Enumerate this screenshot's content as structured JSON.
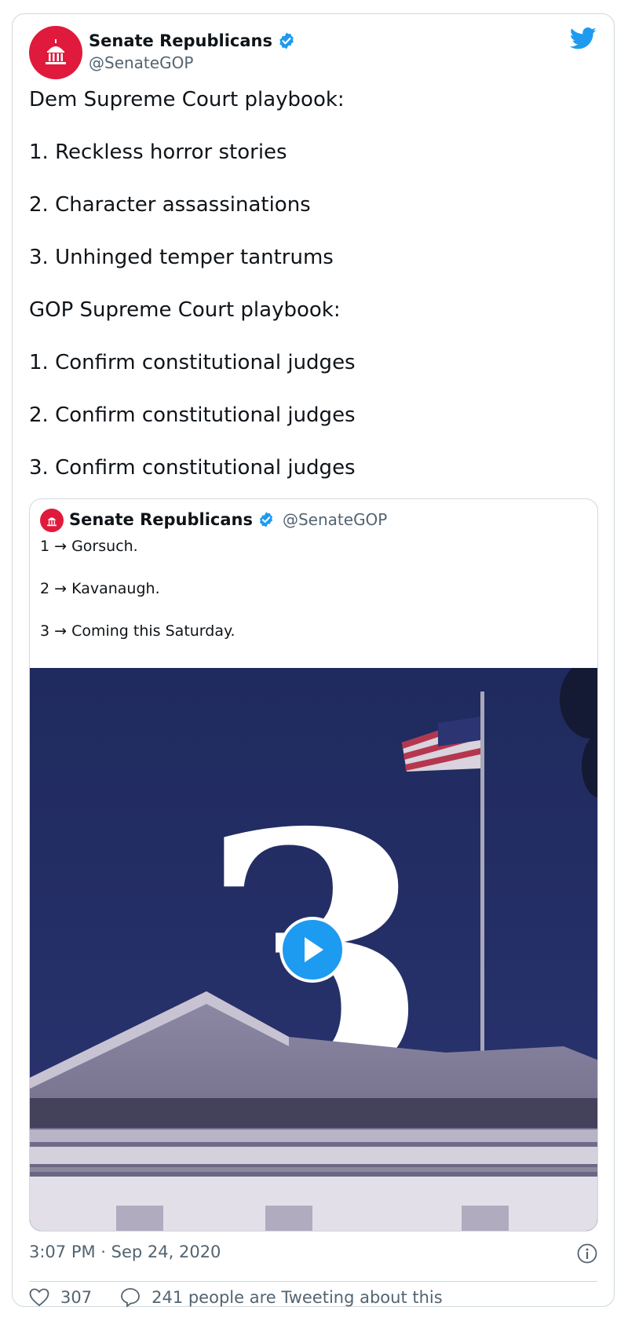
{
  "author": {
    "name": "Senate Republicans",
    "handle": "@SenateGOP",
    "avatar_color": "#e01a3c",
    "verified_icon": "verified-badge-icon"
  },
  "platform_icon": "twitter-bird-icon",
  "tweet": {
    "lines": [
      "Dem Supreme Court playbook:",
      "1. Reckless horror stories",
      "2. Character assassinations",
      "3. Unhinged temper tantrums",
      "GOP Supreme Court playbook:",
      "1. Confirm constitutional judges",
      "2. Confirm constitutional judges",
      "3. Confirm constitutional judges"
    ]
  },
  "quoted_tweet": {
    "name": "Senate Republicans",
    "handle": "@SenateGOP",
    "lines": [
      "1 → Gorsuch.",
      "2 → Kavanaugh.",
      "3 → Coming this Saturday."
    ],
    "media": {
      "type": "video",
      "overlay_number": "3",
      "play_icon": "play-icon"
    }
  },
  "timestamp": "3:07 PM · Sep 24, 2020",
  "footer": {
    "likes": "307",
    "tweeting_about": "241 people are Tweeting about this"
  },
  "colors": {
    "accent": "#1d9bf0",
    "secondary_text": "#536471",
    "border": "#cfd9de"
  }
}
